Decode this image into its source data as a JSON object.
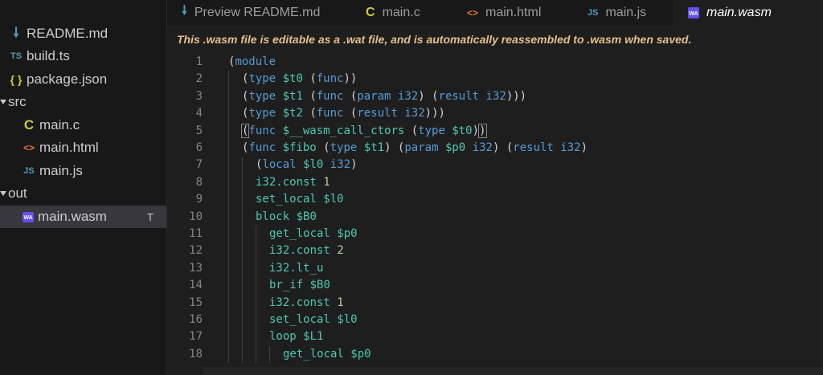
{
  "sidebar": {
    "items": [
      {
        "label": "README.md",
        "icon": "arrow-down-icon",
        "glyph": "🠗",
        "color": "#519aba"
      },
      {
        "label": "build.ts",
        "icon": "ts-icon",
        "glyph": "TS",
        "color": "#519aba"
      },
      {
        "label": "package.json",
        "icon": "braces-icon",
        "glyph": "{ }",
        "color": "#cbcb41"
      },
      {
        "label": "src",
        "folder": true
      },
      {
        "label": "main.c",
        "icon": "c-icon",
        "glyph": "C",
        "color": "#cbcb41"
      },
      {
        "label": "main.html",
        "icon": "html-icon",
        "glyph": "<>",
        "color": "#e37933"
      },
      {
        "label": "main.js",
        "icon": "js-icon",
        "glyph": "JS",
        "color": "#519aba"
      },
      {
        "label": "out",
        "folder": true
      },
      {
        "label": "main.wasm",
        "icon": "wasm-icon",
        "glyph": "WA",
        "color": "#654ff0",
        "badge": "T",
        "selected": true
      }
    ]
  },
  "tabs": [
    {
      "label": "Preview README.md",
      "icon": "arrow-down-icon",
      "glyph": "🠗",
      "color": "#519aba"
    },
    {
      "label": "main.c",
      "icon": "c-icon",
      "glyph": "C",
      "color": "#cbcb41"
    },
    {
      "label": "main.html",
      "icon": "html-icon",
      "glyph": "<>",
      "color": "#e37933"
    },
    {
      "label": "main.js",
      "icon": "js-icon",
      "glyph": "JS",
      "color": "#519aba"
    },
    {
      "label": "main.wasm",
      "icon": "wasm-icon",
      "glyph": "WA",
      "color": "#654ff0",
      "active": true
    }
  ],
  "notice": "This .wasm file is editable as a .wat file, and is automatically reassembled to .wasm when saved.",
  "code": {
    "lines": [
      {
        "n": "1",
        "indent": 0,
        "tokens": [
          [
            "p",
            "("
          ],
          [
            "op",
            "module"
          ]
        ]
      },
      {
        "n": "2",
        "indent": 1,
        "tokens": [
          [
            "p",
            "("
          ],
          [
            "op",
            "type"
          ],
          [
            "p",
            " "
          ],
          [
            "id",
            "$t0"
          ],
          [
            "p",
            " ("
          ],
          [
            "op",
            "func"
          ],
          [
            "p",
            "))"
          ]
        ]
      },
      {
        "n": "3",
        "indent": 1,
        "tokens": [
          [
            "p",
            "("
          ],
          [
            "op",
            "type"
          ],
          [
            "p",
            " "
          ],
          [
            "id",
            "$t1"
          ],
          [
            "p",
            " ("
          ],
          [
            "op",
            "func"
          ],
          [
            "p",
            " ("
          ],
          [
            "op",
            "param"
          ],
          [
            "p",
            " "
          ],
          [
            "ty",
            "i32"
          ],
          [
            "p",
            ") ("
          ],
          [
            "op",
            "result"
          ],
          [
            "p",
            " "
          ],
          [
            "ty",
            "i32"
          ],
          [
            "p",
            ")))"
          ]
        ]
      },
      {
        "n": "4",
        "indent": 1,
        "tokens": [
          [
            "p",
            "("
          ],
          [
            "op",
            "type"
          ],
          [
            "p",
            " "
          ],
          [
            "id",
            "$t2"
          ],
          [
            "p",
            " ("
          ],
          [
            "op",
            "func"
          ],
          [
            "p",
            " ("
          ],
          [
            "op",
            "result"
          ],
          [
            "p",
            " "
          ],
          [
            "ty",
            "i32"
          ],
          [
            "p",
            ")))"
          ]
        ]
      },
      {
        "n": "5",
        "indent": 1,
        "tokens": [
          [
            "b",
            "("
          ],
          [
            "op",
            "func"
          ],
          [
            "p",
            " "
          ],
          [
            "id",
            "$__wasm_call_ctors"
          ],
          [
            "p",
            " ("
          ],
          [
            "op",
            "type"
          ],
          [
            "p",
            " "
          ],
          [
            "id",
            "$t0"
          ],
          [
            "p",
            ")"
          ],
          [
            "b",
            ")"
          ]
        ]
      },
      {
        "n": "6",
        "indent": 1,
        "tokens": [
          [
            "p",
            "("
          ],
          [
            "op",
            "func"
          ],
          [
            "p",
            " "
          ],
          [
            "id",
            "$fibo"
          ],
          [
            "p",
            " ("
          ],
          [
            "op",
            "type"
          ],
          [
            "p",
            " "
          ],
          [
            "id",
            "$t1"
          ],
          [
            "p",
            ") ("
          ],
          [
            "op",
            "param"
          ],
          [
            "p",
            " "
          ],
          [
            "id",
            "$p0"
          ],
          [
            "p",
            " "
          ],
          [
            "ty",
            "i32"
          ],
          [
            "p",
            ") ("
          ],
          [
            "op",
            "result"
          ],
          [
            "p",
            " "
          ],
          [
            "ty",
            "i32"
          ],
          [
            "p",
            ")"
          ]
        ]
      },
      {
        "n": "7",
        "indent": 2,
        "tokens": [
          [
            "p",
            "("
          ],
          [
            "op",
            "local"
          ],
          [
            "p",
            " "
          ],
          [
            "id",
            "$l0"
          ],
          [
            "p",
            " "
          ],
          [
            "ty",
            "i32"
          ],
          [
            "p",
            ")"
          ]
        ]
      },
      {
        "n": "8",
        "indent": 2,
        "tokens": [
          [
            "id",
            "i32.const"
          ],
          [
            "p",
            " "
          ],
          [
            "num",
            "1"
          ]
        ]
      },
      {
        "n": "9",
        "indent": 2,
        "tokens": [
          [
            "id",
            "set_local"
          ],
          [
            "p",
            " "
          ],
          [
            "id",
            "$l0"
          ]
        ]
      },
      {
        "n": "10",
        "indent": 2,
        "tokens": [
          [
            "id",
            "block"
          ],
          [
            "p",
            " "
          ],
          [
            "id",
            "$B0"
          ]
        ]
      },
      {
        "n": "11",
        "indent": 3,
        "tokens": [
          [
            "id",
            "get_local"
          ],
          [
            "p",
            " "
          ],
          [
            "id",
            "$p0"
          ]
        ]
      },
      {
        "n": "12",
        "indent": 3,
        "tokens": [
          [
            "id",
            "i32.const"
          ],
          [
            "p",
            " "
          ],
          [
            "num",
            "2"
          ]
        ]
      },
      {
        "n": "13",
        "indent": 3,
        "tokens": [
          [
            "id",
            "i32.lt_u"
          ]
        ]
      },
      {
        "n": "14",
        "indent": 3,
        "tokens": [
          [
            "id",
            "br_if"
          ],
          [
            "p",
            " "
          ],
          [
            "id",
            "$B0"
          ]
        ]
      },
      {
        "n": "15",
        "indent": 3,
        "tokens": [
          [
            "id",
            "i32.const"
          ],
          [
            "p",
            " "
          ],
          [
            "num",
            "1"
          ]
        ]
      },
      {
        "n": "16",
        "indent": 3,
        "tokens": [
          [
            "id",
            "set_local"
          ],
          [
            "p",
            " "
          ],
          [
            "id",
            "$l0"
          ]
        ]
      },
      {
        "n": "17",
        "indent": 3,
        "tokens": [
          [
            "id",
            "loop"
          ],
          [
            "p",
            " "
          ],
          [
            "id",
            "$L1"
          ]
        ]
      },
      {
        "n": "18",
        "indent": 4,
        "tokens": [
          [
            "id",
            "get_local"
          ],
          [
            "p",
            " "
          ],
          [
            "id",
            "$p0"
          ]
        ]
      }
    ]
  }
}
